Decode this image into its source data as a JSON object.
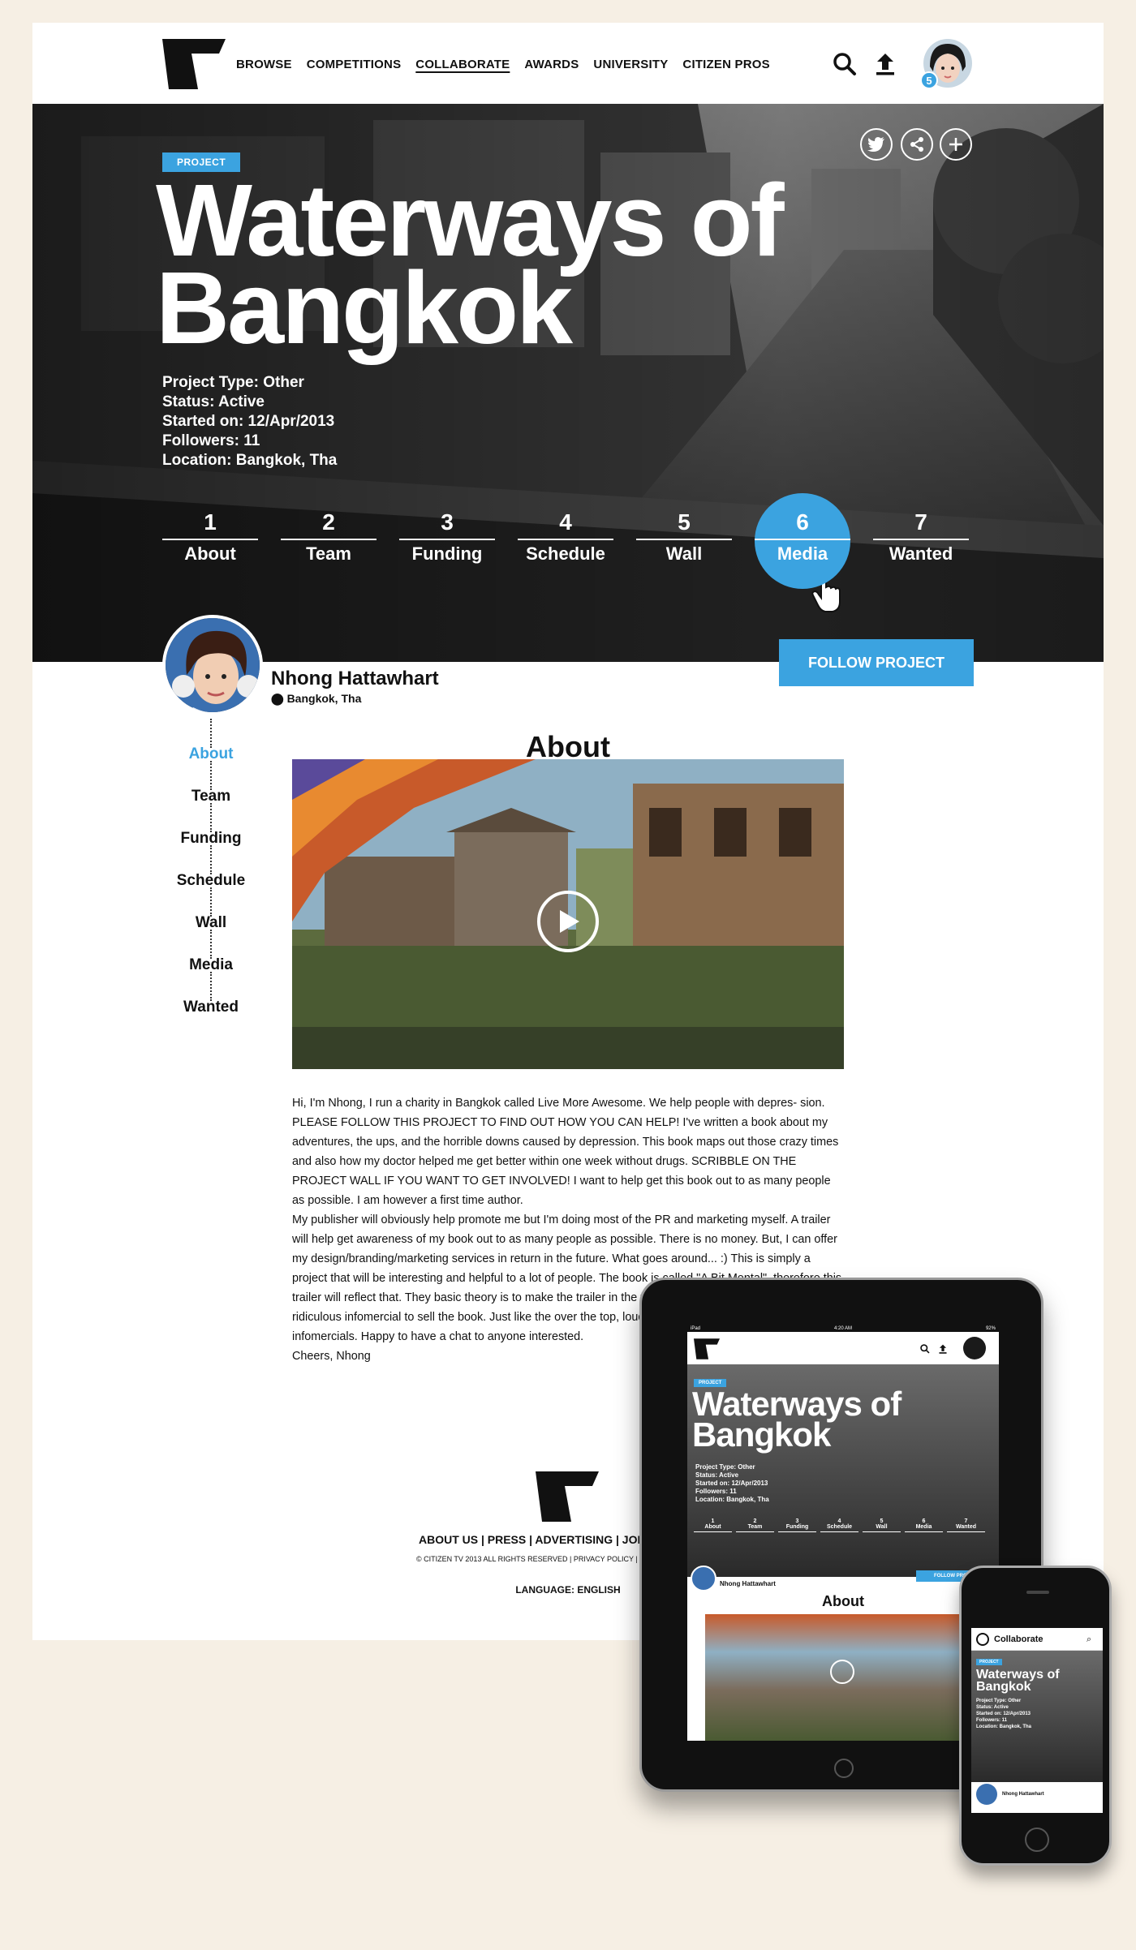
{
  "header": {
    "nav": [
      "BROWSE",
      "COMPETITIONS",
      "COLLABORATE",
      "AWARDS",
      "UNIVERSITY",
      "CITIZEN PROS"
    ],
    "active_nav": "COLLABORATE",
    "notification_count": "5"
  },
  "hero": {
    "tag": "PROJECT",
    "title": "Waterways of Bangkok",
    "meta": [
      "Project Type: Other",
      "Status: Active",
      "Started on: 12/Apr/2013",
      "Followers: 11",
      "Location: Bangkok, Tha"
    ],
    "steps": [
      {
        "num": "1",
        "label": "About"
      },
      {
        "num": "2",
        "label": "Team"
      },
      {
        "num": "3",
        "label": "Funding"
      },
      {
        "num": "4",
        "label": "Schedule"
      },
      {
        "num": "5",
        "label": "Wall"
      },
      {
        "num": "6",
        "label": "Media"
      },
      {
        "num": "7",
        "label": "Wanted"
      }
    ],
    "active_step": "Media"
  },
  "profile": {
    "name": "Nhong Hattawhart",
    "location": "Bangkok, Tha",
    "follow_label": "FOLLOW PROJECT"
  },
  "sidenav": {
    "items": [
      "About",
      "Team",
      "Funding",
      "Schedule",
      "Wall",
      "Media",
      "Wanted"
    ],
    "active": "About"
  },
  "about": {
    "heading": "About",
    "paragraphs": [
      "Hi, I'm Nhong, I run a charity in Bangkok called Live More Awesome. We help people with depres- sion. PLEASE FOLLOW THIS PROJECT TO FIND OUT HOW YOU CAN HELP! I've written a book about my adventures, the ups, and the horrible downs caused by depression. This book maps out those crazy times and also how my doctor helped me get better within one week without drugs. SCRIBBLE ON THE PROJECT WALL IF YOU WANT TO GET INVOLVED! I want to help get this book out to as many people as possible. I am however a first time author.",
      "My publisher will obviously help promote me but I'm doing most of the PR and marketing myself. A trailer will help get awareness of my book out to as many people as possible. There is no money. But, I can offer my design/branding/marketing services in return in the future. What goes around... :) This is simply a project that will be interesting and helpful to a lot of people. The book is called \"A Bit Mental\", therefore this trailer will reflect that. They basic theory is to make the trailer in the form of a completely mock and ridiculous infomercial to sell the book. Just like the over the top, loud and silly things people do on regular infomercials. Happy to have a chat to anyone interested.",
      "Cheers, Nhong"
    ]
  },
  "footer": {
    "links": "ABOUT US | PRESS | ADVERTISING | JOBS | CONTACT",
    "copyright": "© CITIZEN TV 2013 ALL RIGHTS RESERVED | PRIVACY POLICY | TERMS & CONDITIONS",
    "language": "LANGUAGE: ENGLISH"
  },
  "tablet": {
    "status_left": "iPad",
    "status_time": "4:20 AM",
    "status_battery": "92%",
    "follow_label": "FOLLOW PROJECT"
  },
  "phone": {
    "title": "Collaborate"
  },
  "colors": {
    "accent": "#3ba3e0",
    "page_bg": "#f6efe4"
  }
}
